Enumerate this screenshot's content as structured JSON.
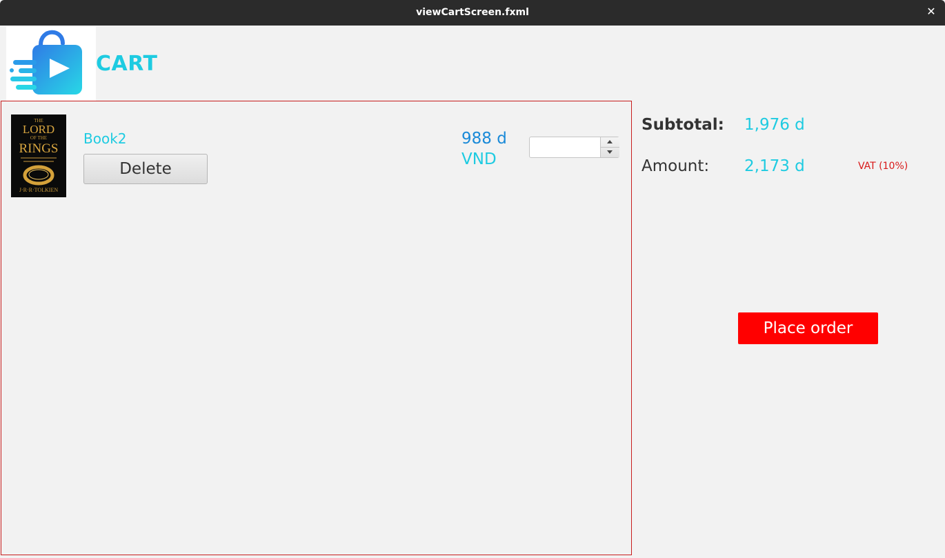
{
  "window": {
    "title": "viewCartScreen.fxml",
    "close_glyph": "✕"
  },
  "header": {
    "logo_icon": "shopping-bag-arrow-logo",
    "title": "CART"
  },
  "cart": {
    "items": [
      {
        "title": "Book2",
        "cover": {
          "line1": "THE",
          "line2": "LORD",
          "line3": "OF THE",
          "line4": "RINGS",
          "author": "J·R·R·TOLKIEN"
        },
        "delete_label": "Delete",
        "price": "988 d",
        "currency": "VND",
        "quantity": ""
      }
    ]
  },
  "summary": {
    "subtotal_label": "Subtotal:",
    "subtotal_value": "1,976 d",
    "amount_label": "Amount:",
    "amount_value": "2,173 d",
    "vat_note": "VAT (10%)"
  },
  "actions": {
    "place_order_label": "Place order"
  },
  "colors": {
    "accent": "#1ecbe1",
    "price": "#1a8ad8",
    "danger": "#ff0000",
    "border": "#c71c1c"
  }
}
